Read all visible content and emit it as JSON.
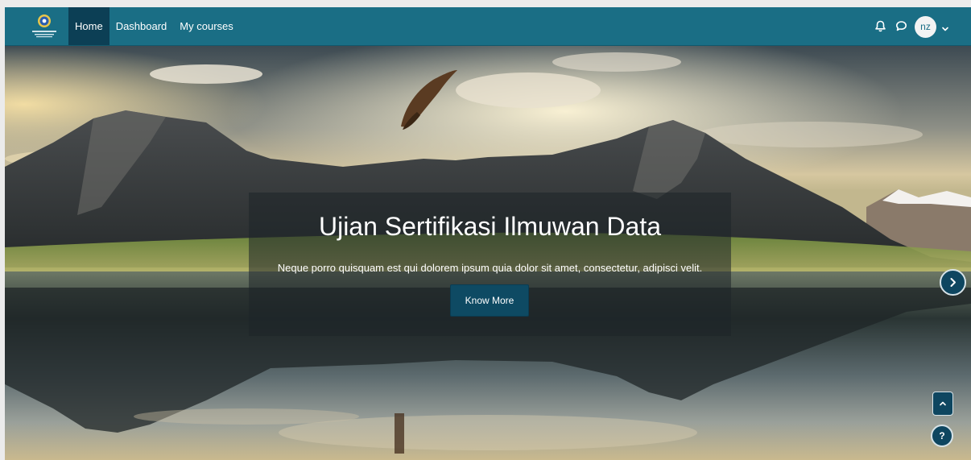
{
  "navbar": {
    "logo_icon": "site-logo",
    "links": [
      {
        "label": "Home",
        "active": true
      },
      {
        "label": "Dashboard",
        "active": false
      },
      {
        "label": "My courses",
        "active": false
      }
    ],
    "notification_icon": "bell-icon",
    "messages_icon": "chat-icon",
    "user_initials": "nz",
    "user_menu_icon": "chevron-down-icon"
  },
  "hero": {
    "background": "mountain-lake-eagle-landscape",
    "title": "Ujian Sertifikasi Ilmuwan Data",
    "description": "Neque porro quisquam est qui dolorem ipsum quia dolor sit amet, consectetur, adipisci velit.",
    "button_label": "Know More",
    "next_icon": "chevron-right-icon"
  },
  "floating": {
    "back_to_top_icon": "chevron-up-icon",
    "help_label": "?"
  },
  "colors": {
    "navbar": "#1a6e85",
    "nav_active": "#0c3f55",
    "button": "#0e4a63"
  }
}
